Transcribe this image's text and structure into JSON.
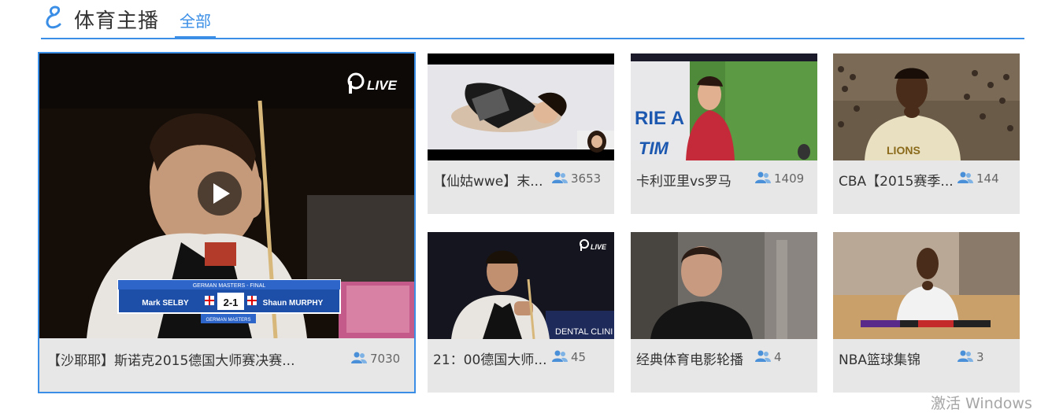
{
  "header": {
    "title": "体育主播",
    "tab_all": "全部"
  },
  "featured": {
    "caption": "【沙耶耶】斯诺克2015德国大师赛决赛...",
    "viewers": "7030",
    "scoreboard": {
      "event": "GERMAN MASTERS - FINAL",
      "player1": "Mark SELBY",
      "score": "2-1",
      "player2": "Shaun MURPHY",
      "sub": "GERMAN MASTERS"
    },
    "live_badge": "LIVE"
  },
  "streams": [
    {
      "caption": "【仙姑wwe】末...",
      "viewers": "3653"
    },
    {
      "caption": "卡利亚里vs罗马",
      "viewers": "1409"
    },
    {
      "caption": "CBA【2015赛季...",
      "viewers": "144"
    },
    {
      "caption": "21：00德国大师...",
      "viewers": "45"
    },
    {
      "caption": "经典体育电影轮播",
      "viewers": "4"
    },
    {
      "caption": "NBA篮球集锦",
      "viewers": "3"
    }
  ],
  "thumb_text": {
    "serie_a": "RIE A",
    "tim": "TIM",
    "lions": "LIONS",
    "live": "LIVE",
    "dental": "DENTAL CLINI"
  },
  "colors": {
    "accent": "#3a8ee6",
    "card_bg": "#e7e7e7",
    "viewer_icon": "#4a90d9"
  },
  "watermark": "激活 Windows"
}
